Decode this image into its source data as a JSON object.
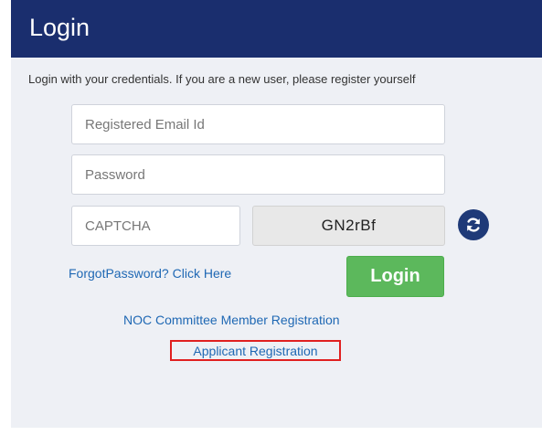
{
  "header": {
    "title": "Login"
  },
  "intro": "Login with your credentials. If you are a new user, please register yourself",
  "form": {
    "email_placeholder": "Registered Email Id",
    "password_placeholder": "Password",
    "captcha_placeholder": "CAPTCHA",
    "captcha_code": "GN2rBf",
    "refresh_icon": "refresh-icon"
  },
  "links": {
    "forgot": "ForgotPassword? Click Here",
    "noc": "NOC Committee Member Registration",
    "applicant": "Applicant Registration"
  },
  "buttons": {
    "login": "Login"
  },
  "colors": {
    "header": "#1a2e6e",
    "login_button": "#5cb85c",
    "link": "#1f68b4",
    "highlight_box": "#e02020"
  }
}
